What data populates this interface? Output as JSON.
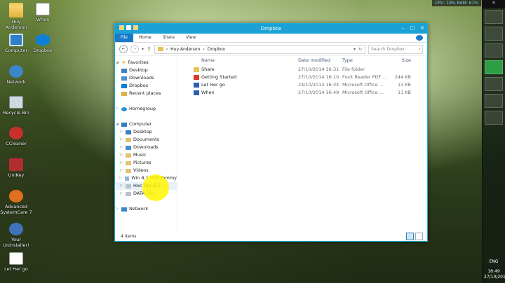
{
  "desktop": {
    "icons": [
      {
        "label": "Huy\nAnderson",
        "icon": "folder-icon"
      },
      {
        "label": "When",
        "icon": "document-icon"
      },
      {
        "label": "Computer",
        "icon": "computer-icon"
      },
      {
        "label": "Dropbox",
        "icon": "dropbox-icon"
      },
      {
        "label": "Network",
        "icon": "network-icon"
      },
      {
        "label": "Recycle Bin",
        "icon": "recycle-bin-icon"
      },
      {
        "label": "CCleaner",
        "icon": "ccleaner-icon"
      },
      {
        "label": "UniKey",
        "icon": "unikey-icon"
      },
      {
        "label": "Advanced\nSystemCare 7",
        "icon": "advanced-systemcare-icon"
      },
      {
        "label": "Your\nUninstaller!",
        "icon": "uninstaller-icon"
      },
      {
        "label": "Let Her go",
        "icon": "document-icon"
      }
    ]
  },
  "meter": {
    "text": "CPU: 19%   RAM: 61%"
  },
  "tray": {
    "lang": "ENG",
    "time": "16:49",
    "date": "27/10/201"
  },
  "window": {
    "title": "Dropbox",
    "ribbon_tabs": [
      "File",
      "Home",
      "Share",
      "View"
    ],
    "address": {
      "part1": "Huy Anderson",
      "part2": "Dropbox"
    },
    "search_placeholder": "Search Dropbox",
    "nav": {
      "favorites": "Favorites",
      "fav_items": [
        "Desktop",
        "Downloads",
        "Dropbox",
        "Recent places"
      ],
      "homegroup": "Homegroup",
      "computer": "Computer",
      "comp_items": [
        "Desktop",
        "Documents",
        "Downloads",
        "Music",
        "Pictures",
        "Videos",
        "Win 8.1 VS8 Tommy",
        "Hoc Tap (E:)",
        "DATA (G:)"
      ],
      "network": "Network"
    },
    "columns": {
      "name": "Name",
      "date": "Date modified",
      "type": "Type",
      "size": "Size"
    },
    "files": [
      {
        "name": "Share",
        "date": "27/10/2014 16:31",
        "type": "File folder",
        "size": ""
      },
      {
        "name": "Getting Started",
        "date": "27/10/2014 16:10",
        "type": "Foxit Reader PDF ...",
        "size": "244 KB"
      },
      {
        "name": "Let Her go",
        "date": "24/10/2014 16:34",
        "type": "Microsoft Office ...",
        "size": "13 KB"
      },
      {
        "name": "When",
        "date": "27/10/2014 16:49",
        "type": "Microsoft Office ...",
        "size": "11 KB"
      }
    ],
    "status": "4 items"
  }
}
